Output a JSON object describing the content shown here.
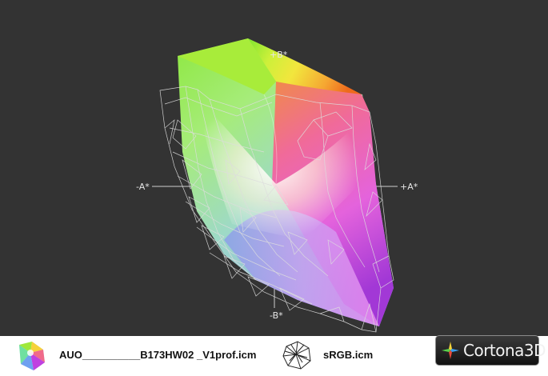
{
  "axes": {
    "plus_b": "+B*",
    "minus_b": "-B*",
    "minus_a": "-A*",
    "plus_a": "+A*"
  },
  "legend": {
    "item1": {
      "label": "AUO__________B173HW02 _V1prof.icm",
      "icon": "color-gamut-icon"
    },
    "item2": {
      "label": "sRGB.icm",
      "icon": "wireframe-gamut-icon"
    }
  },
  "logo": {
    "text": "Cortona3D",
    "icon": "cortona-star-icon"
  },
  "colors": {
    "background": "#333333",
    "axis": "#cccccc",
    "wireframe": "#dcdcdc"
  }
}
